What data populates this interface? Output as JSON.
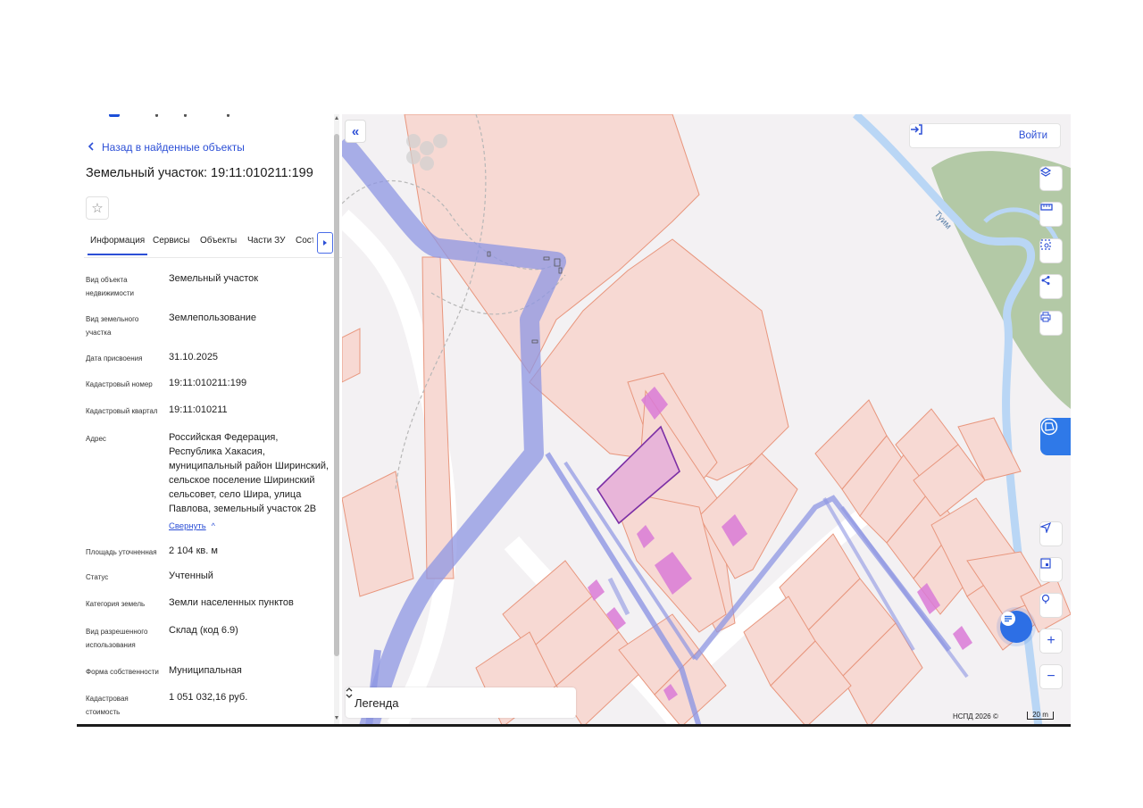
{
  "panel": {
    "back_label": "Назад в найденные объекты",
    "title": "Земельный участок: 19:11:010211:199",
    "tabs": [
      "Информация",
      "Сервисы",
      "Объекты",
      "Части ЗУ",
      "Сост"
    ],
    "fields": [
      {
        "label": "Вид объекта недвижимости",
        "value": "Земельный участок"
      },
      {
        "label": "Вид земельного участка",
        "value": "Землепользование"
      },
      {
        "label": "Дата присвоения",
        "value": "31.10.2025"
      },
      {
        "label": "Кадастровый номер",
        "value": "19:11:010211:199"
      },
      {
        "label": "Кадастровый квартал",
        "value": "19:11:010211"
      },
      {
        "label": "Адрес",
        "value": "Российская Федерация, Республика Хакасия, муниципальный район Ширинский, сельское поселение Ширинский сельсовет, село Шира, улица Павлова, земельный участок 2В"
      },
      {
        "label": "Площадь уточненная",
        "value": "2 104 кв. м"
      },
      {
        "label": "Статус",
        "value": "Учтенный"
      },
      {
        "label": "Категория земель",
        "value": "Земли населенных пунктов"
      },
      {
        "label": "Вид разрешенного использования",
        "value": "Склад (код 6.9)"
      },
      {
        "label": "Форма собственности",
        "value": "Муниципальная"
      },
      {
        "label": "Кадастровая стоимость",
        "value": "1 051 032,16 руб."
      }
    ],
    "collapse_label": "Свернуть"
  },
  "map": {
    "login_label": "Войти",
    "legend_label": "Легенда",
    "river_label": "Туим",
    "attribution": "НСПД 2026 ©",
    "scale_label": "20 m",
    "zoom_in": "+",
    "zoom_out": "−",
    "colors": {
      "parcel_fill": "#f7d9d3",
      "parcel_stroke": "#e8967d",
      "road": "#8d96e3",
      "building": "#d97ad6",
      "selected_stroke": "#7c2fa5",
      "river": "#b9d6f5",
      "forest": "#b3c9a6"
    },
    "toolbar_icons": [
      "layers-icon",
      "ruler-icon",
      "select-area-icon",
      "share-icon",
      "print-icon"
    ],
    "bottom_icons": [
      "navigate-icon",
      "map-type-icon",
      "location-icon"
    ]
  }
}
